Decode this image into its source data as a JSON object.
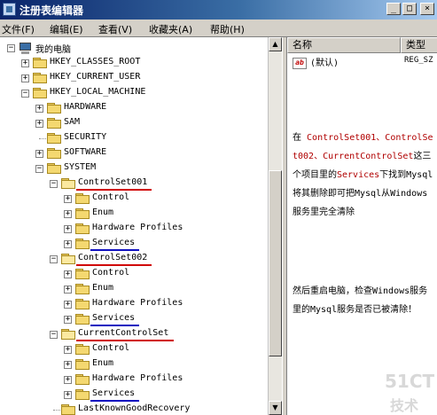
{
  "window": {
    "title": "注册表编辑器",
    "buttons": {
      "minimize": "_",
      "maximize": "□",
      "close": "×"
    }
  },
  "menu": [
    "文件(F)",
    "编辑(E)",
    "查看(V)",
    "收藏夹(A)",
    "帮助(H)"
  ],
  "tree": {
    "root": "我的电脑",
    "hives": [
      "HKEY_CLASSES_ROOT",
      "HKEY_CURRENT_USER",
      "HKEY_LOCAL_MACHINE"
    ],
    "hklm_children": [
      "HARDWARE",
      "SAM",
      "SECURITY",
      "SOFTWARE",
      "SYSTEM"
    ],
    "controlsets": [
      {
        "name": "ControlSet001",
        "children": [
          "Control",
          "Enum",
          "Hardware Profiles",
          "Services"
        ]
      },
      {
        "name": "ControlSet002",
        "children": [
          "Control",
          "Enum",
          "Hardware Profiles",
          "Services"
        ]
      },
      {
        "name": "CurrentControlSet",
        "children": [
          "Control",
          "Enum",
          "Hardware Profiles",
          "Services"
        ]
      }
    ],
    "last": "LastKnownGoodRecovery",
    "expand_plus": "+",
    "expand_minus": "−"
  },
  "list": {
    "columns": [
      "名称",
      "类型"
    ],
    "rows": [
      {
        "icon": "ab",
        "name": "(默认)",
        "type": "REG_SZ"
      }
    ]
  },
  "annotation": {
    "p1_pre": "在 ",
    "p1_red": "ControlSet001、ControlSet002、CurrentControlSet",
    "p1_post": "这三个项目里的",
    "p1_red2": "Services",
    "p1_tail": "下找到Mysql将其删除即可把Mysql从Windows服务里完全清除",
    "p2": "然后重启电脑，检查Windows服务里的Mysql服务是否已被清除！"
  },
  "watermark": {
    "line1": "51CT",
    "line2": "技术"
  },
  "colors": {
    "underline_red": "#d00000",
    "underline_blue": "#1010c0",
    "title_start": "#0a246a",
    "title_end": "#a6caf0"
  }
}
